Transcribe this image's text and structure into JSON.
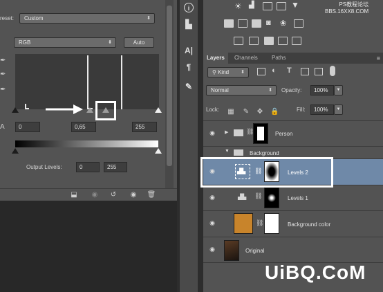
{
  "properties": {
    "preset_label": "reset:",
    "preset_value": "Custom",
    "channel_value": "RGB",
    "auto_label": "Auto",
    "input_black": "0",
    "input_gamma": "0,65",
    "input_white": "255",
    "output_label": "Output Levels:",
    "output_black": "0",
    "output_white": "255",
    "gamma_slider_fraction": 0.65
  },
  "toolstrip": {
    "items": [
      "info-icon",
      "histogram-icon",
      "character-icon",
      "paragraph-icon",
      "brush-icon"
    ],
    "char_glyph": "A|",
    "para_glyph": "¶"
  },
  "watermark": {
    "line1": "PS教程论坛",
    "line2": "BBS.16XX8.COM"
  },
  "layers": {
    "tabs": [
      "Layers",
      "Channels",
      "Paths"
    ],
    "kind_label": "Kind",
    "blend_mode": "Normal",
    "opacity_label": "Opacity:",
    "opacity_value": "100%",
    "lock_label": "Lock:",
    "fill_label": "Fill:",
    "fill_value": "100%",
    "rows": [
      {
        "name": "Person"
      },
      {
        "name": "Background"
      },
      {
        "name": "Levels 2"
      },
      {
        "name": "Levels 1"
      },
      {
        "name": "Background color"
      },
      {
        "name": "Original"
      }
    ]
  },
  "colors": {
    "selected_row": "#6f89a8",
    "panel_bg": "#535353",
    "bg_color_swatch": "#c8842b"
  },
  "logo": "UiBQ.CoM"
}
